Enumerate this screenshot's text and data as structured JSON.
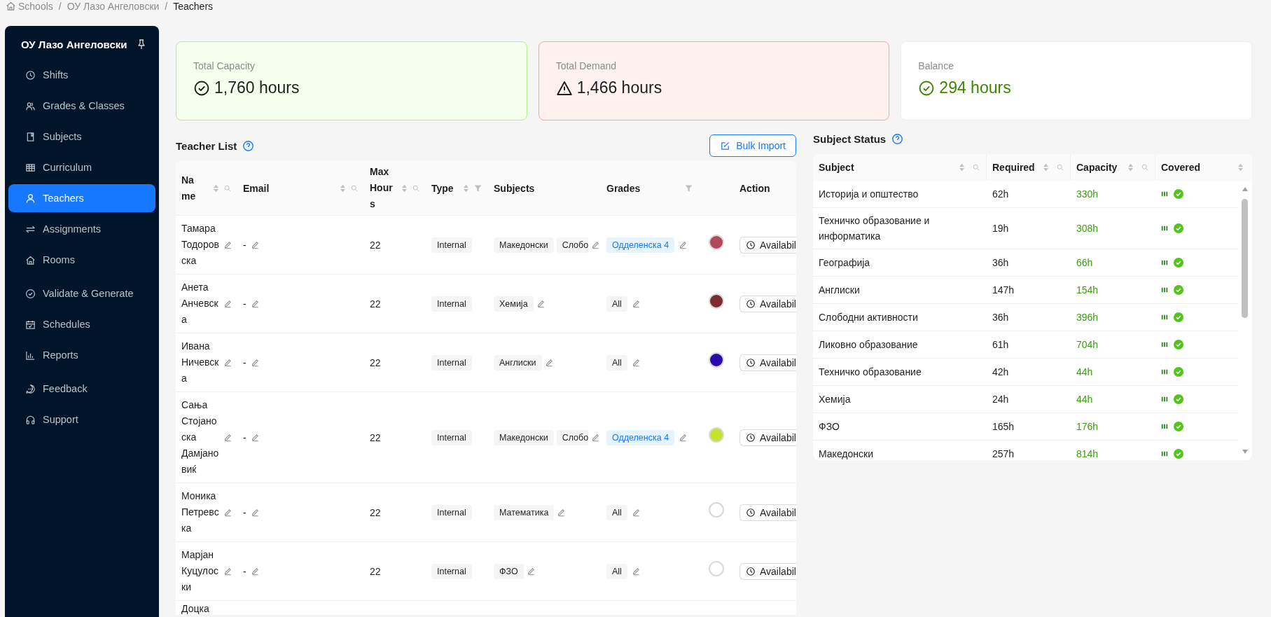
{
  "breadcrumb": [
    {
      "label": "Schools",
      "current": false
    },
    {
      "separator": "/",
      "label": "ОУ Лазо Ангеловски",
      "current": false
    },
    {
      "separator": "/",
      "label": "Teachers",
      "current": true
    }
  ],
  "sidebar": {
    "title": "ОУ Лазо Ангеловски",
    "items": [
      {
        "label": "Shifts",
        "selected": false
      },
      {
        "label": "Grades & Classes",
        "selected": false
      },
      {
        "label": "Subjects",
        "selected": false
      },
      {
        "label": "Curriculum",
        "selected": false
      },
      {
        "label": "Teachers",
        "selected": true
      },
      {
        "label": "Assignments",
        "selected": false
      },
      {
        "label": "Rooms",
        "selected": false
      },
      {
        "label": "Validate & Generate",
        "selected": false
      },
      {
        "label": "Schedules",
        "selected": false
      },
      {
        "label": "Reports",
        "selected": false
      },
      {
        "label": "Feedback",
        "selected": false
      },
      {
        "label": "Support",
        "selected": false
      }
    ]
  },
  "cards": [
    {
      "kind": "capacity",
      "label": "Total Capacity",
      "value": "1,760 hours"
    },
    {
      "kind": "demand",
      "label": "Total Demand",
      "value": "1,466 hours"
    },
    {
      "kind": "balance",
      "label": "Balance",
      "value": "294 hours"
    }
  ],
  "teacher_list": {
    "title": "Teacher List",
    "bulk_import": "Bulk Import",
    "columns": [
      {
        "label": "Name",
        "sortable": true,
        "searchable": true,
        "filterable": false
      },
      {
        "label": "Email",
        "sortable": true,
        "searchable": true,
        "filterable": false
      },
      {
        "label": "Max Hours",
        "sortable": true,
        "searchable": true,
        "filterable": false
      },
      {
        "label": "Type",
        "sortable": true,
        "searchable": false,
        "filterable": true
      },
      {
        "label": "Subjects",
        "sortable": false,
        "searchable": false,
        "filterable": false
      },
      {
        "label": "Grades",
        "sortable": false,
        "searchable": false,
        "filterable": true
      },
      {
        "sortable": false,
        "searchable": false,
        "filterable": false
      },
      {
        "label": "Action",
        "sortable": false,
        "searchable": false,
        "filterable": false
      }
    ],
    "rows": [
      {
        "name": "Тамара Тодоровска",
        "email": "-",
        "max_hours": "22",
        "type": "Internal",
        "subjects": [
          "Македонски",
          "Слобо"
        ],
        "grades": [
          {
            "label": "Одделенска 4",
            "kind": "class"
          }
        ],
        "color": "#b04a5a",
        "action": "Availabil"
      },
      {
        "name": "Анета Анчевска",
        "email": "-",
        "max_hours": "22",
        "type": "Internal",
        "subjects": [
          "Хемија"
        ],
        "grades": [
          {
            "label": "All",
            "kind": "all"
          }
        ],
        "color": "#7b2d30",
        "action": "Availabil"
      },
      {
        "name": "Ивана Ничевска",
        "email": "-",
        "max_hours": "22",
        "type": "Internal",
        "subjects": [
          "Англиски"
        ],
        "grades": [
          {
            "label": "All",
            "kind": "all"
          }
        ],
        "color": "#2a0aa8",
        "action": "Availabil"
      },
      {
        "name": "Сања Стојаноска Дамјановиќ",
        "email": "-",
        "max_hours": "22",
        "type": "Internal",
        "subjects": [
          "Македонски",
          "Слобо"
        ],
        "grades": [
          {
            "label": "Одделенска 4",
            "kind": "class"
          }
        ],
        "color": "#c4e32e",
        "action": "Availabil"
      },
      {
        "name": "Моника Петревска",
        "email": "-",
        "max_hours": "22",
        "type": "Internal",
        "subjects": [
          "Математика"
        ],
        "grades": [
          {
            "label": "All",
            "kind": "all"
          }
        ],
        "action": "Availabil"
      },
      {
        "name": "Марјан Куцулоски",
        "email": "-",
        "max_hours": "22",
        "type": "Internal",
        "subjects": [
          "ФЗО"
        ],
        "grades": [
          {
            "label": "All",
            "kind": "all"
          }
        ],
        "action": "Availabil"
      },
      {
        "name": "Доцка"
      }
    ]
  },
  "subject_status": {
    "title": "Subject Status",
    "columns": [
      {
        "label": "Subject",
        "sortable": true,
        "searchable": true
      },
      {
        "label": "Required",
        "sortable": true,
        "searchable": true
      },
      {
        "label": "Capacity",
        "sortable": true,
        "searchable": true
      },
      {
        "label": "Covered",
        "sortable": true,
        "searchable": false
      }
    ],
    "rows": [
      {
        "subject": "Историја и општество",
        "required": "62h",
        "capacity": "330h",
        "covered": true
      },
      {
        "subject": "Техничко образование и информатика",
        "required": "19h",
        "capacity": "308h",
        "covered": true
      },
      {
        "subject": "Географија",
        "required": "36h",
        "capacity": "66h",
        "covered": true
      },
      {
        "subject": "Англиски",
        "required": "147h",
        "capacity": "154h",
        "covered": true
      },
      {
        "subject": "Слободни активности",
        "required": "36h",
        "capacity": "396h",
        "covered": true
      },
      {
        "subject": "Ликовно образование",
        "required": "61h",
        "capacity": "704h",
        "covered": true
      },
      {
        "subject": "Техничко образование",
        "required": "42h",
        "capacity": "44h",
        "covered": true
      },
      {
        "subject": "Хемија",
        "required": "24h",
        "capacity": "44h",
        "covered": true
      },
      {
        "subject": "ФЗО",
        "required": "165h",
        "capacity": "176h",
        "covered": true
      },
      {
        "subject": "Македонски",
        "required": "257h",
        "capacity": "814h",
        "covered": true
      }
    ]
  }
}
